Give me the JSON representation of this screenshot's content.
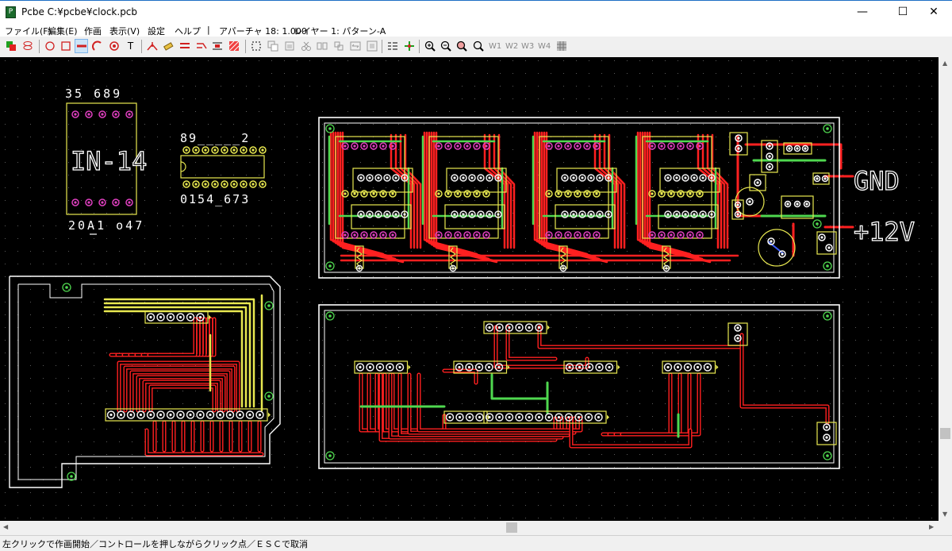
{
  "window": {
    "title": "Pcbe C:¥pcbe¥clock.pcb",
    "app_icon": "pcbe-icon",
    "controls": {
      "minimize": "—",
      "maximize": "☐",
      "close": "✕"
    }
  },
  "menu": {
    "items": [
      {
        "label": "ファイル(F)"
      },
      {
        "label": "編集(E)"
      },
      {
        "label": "作画"
      },
      {
        "label": "表示(V)"
      },
      {
        "label": "設定"
      },
      {
        "label": "ヘルプ"
      }
    ],
    "separator": "|",
    "aperture": "アパーチャ 18: 1.000",
    "layer": "レイヤー 1: パターン-A"
  },
  "toolbar": {
    "windows": [
      "W1",
      "W2",
      "W3",
      "W4"
    ]
  },
  "board": {
    "silk_labels": {
      "ic_top": "35  689",
      "ic_mid": "IN-14",
      "ic_bottom": "20A1 o47",
      "dip_top": "89_____2",
      "dip_bottom": "0154_673",
      "gnd": "GND",
      "v12": "+12V"
    }
  },
  "status": {
    "text": "左クリックで作画開始／コントロールを押しながらクリック点／ＥＳＣで取消"
  },
  "colors": {
    "trace_red": "#ff2020",
    "trace_green": "#4fd84f",
    "outline_yellow": "#e8e850",
    "pad_magenta": "#e040c0",
    "outline_white": "#ffffff",
    "background": "#000000"
  }
}
